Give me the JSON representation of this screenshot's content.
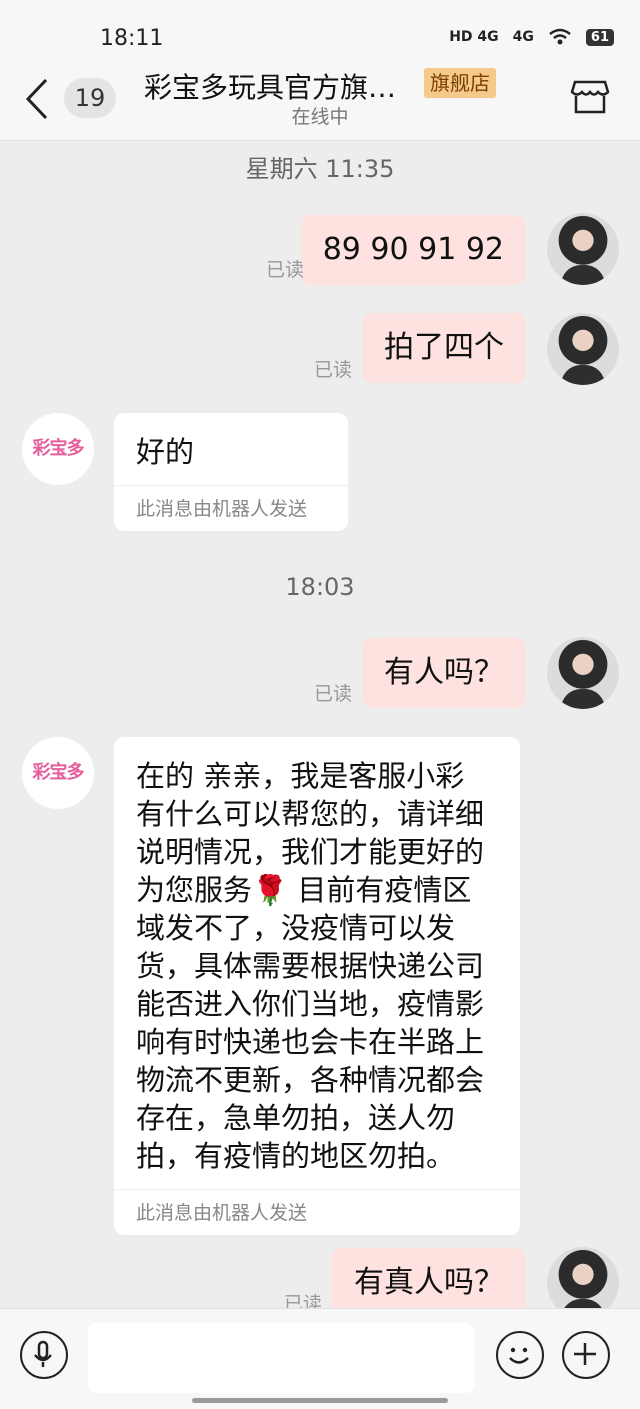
{
  "status_bar": {
    "time": "18:11",
    "network_1": "HD 4G",
    "network_2": "4G",
    "battery": "61"
  },
  "header": {
    "back_icon": "chevron-left-icon",
    "unread_count": "19",
    "shop_name": "彩宝多玩具官方旗…",
    "shop_tag": "旗舰店",
    "online_status": "在线中",
    "store_icon": "storefront-icon"
  },
  "chat": {
    "timestamp_1": "星期六 11:35",
    "messages_1": [
      {
        "from": "me",
        "text": "89 90 91 92",
        "read": "已读"
      },
      {
        "from": "me",
        "text": "拍了四个",
        "read": "已读"
      }
    ],
    "shop_logo_text": "彩宝多",
    "shop_reply_1": {
      "text": "好的",
      "note": "此消息由机器人发送"
    },
    "timestamp_2": "18:03",
    "my_question_1": {
      "text": "有人吗？",
      "read": "已读"
    },
    "shop_reply_2": {
      "lines": [
        "在的 亲亲，我是客服小彩",
        "有什么可以帮您的，请详细",
        "说明情况，我们才能更好的",
        "为您服务🌹 目前有疫情区",
        "域发不了，没疫情可以发",
        "货，具体需要根据快递公司",
        "能否进入你们当地，疫情影",
        "响有时快递也会卡在半路上",
        "物流不更新，各种情况都会",
        "存在，急单勿拍，送人勿",
        "拍，有疫情的地区勿拍。"
      ],
      "note": "此消息由机器人发送"
    },
    "my_question_2": {
      "text": "有真人吗？",
      "read": "已读"
    }
  },
  "input_bar": {
    "mic_icon": "microphone-icon",
    "input_value": "",
    "emoji_icon": "smiley-icon",
    "plus_icon": "plus-icon"
  }
}
